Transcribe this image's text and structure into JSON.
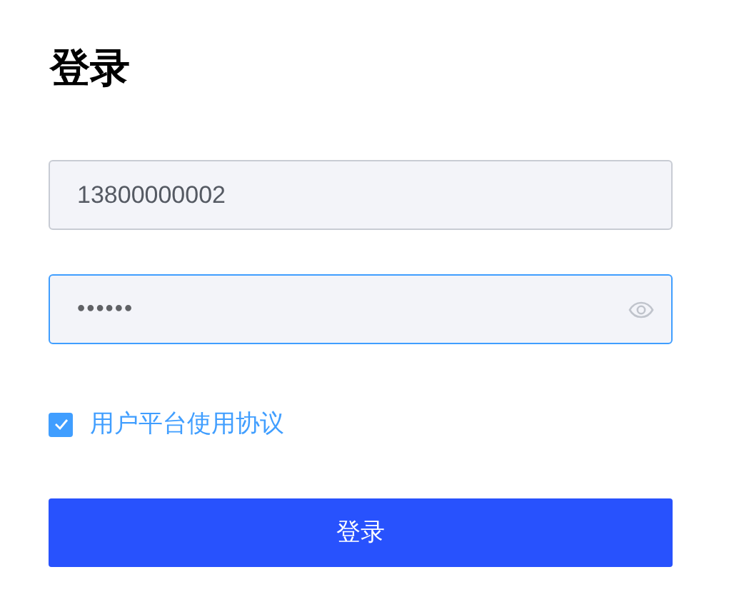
{
  "title": "登录",
  "fields": [
    {
      "kind": "text",
      "value": "13800000002",
      "focused": false
    },
    {
      "kind": "password",
      "value": "••••••",
      "focused": true
    }
  ],
  "agreement": {
    "checked": true,
    "label": "用户平台使用协议"
  },
  "submit": "登录"
}
